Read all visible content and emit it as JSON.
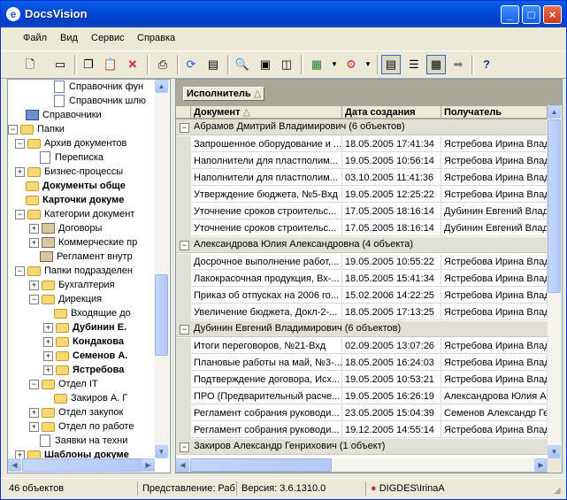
{
  "window": {
    "title": "DocsVision",
    "app_icon": "docsvision-logo-icon",
    "controls": [
      "minimize-icon",
      "maximize-icon",
      "close-icon"
    ]
  },
  "menu": [
    "Файл",
    "Вид",
    "Сервис",
    "Справка"
  ],
  "toolbar_icons": [
    "new-document-icon",
    "new-folder-icon",
    "copy-icon",
    "paste-icon",
    "delete-icon",
    "print-icon",
    "refresh-icon",
    "properties-icon",
    "search-icon",
    "find-card-icon",
    "find-folder-icon",
    "excel-export-icon",
    "settings-icon",
    "view-tree-icon",
    "view-list-icon",
    "view-details-icon",
    "forward-icon",
    "help-icon"
  ],
  "tree": {
    "items": [
      {
        "label": "Справочник фун",
        "level": 3,
        "icon": "reference-icon",
        "expander": "",
        "bold": false
      },
      {
        "label": "Справочник шлю",
        "level": 3,
        "icon": "reference-icon",
        "expander": "",
        "bold": false
      },
      {
        "label": "Справочники",
        "level": 1,
        "icon": "book-icon",
        "expander": "",
        "bold": false
      },
      {
        "label": "Папки",
        "level": 0,
        "icon": "folder-icon",
        "expander": "−",
        "bold": false
      },
      {
        "label": "Архив документов",
        "level": 1,
        "icon": "folder-icon",
        "expander": "−",
        "bold": false
      },
      {
        "label": "Переписка",
        "level": 2,
        "icon": "document-icon",
        "expander": "",
        "bold": false
      },
      {
        "label": "Бизнес-процессы",
        "level": 1,
        "icon": "folder-icon",
        "expander": "+",
        "bold": false
      },
      {
        "label": "Документы обще",
        "level": 1,
        "icon": "folder-icon",
        "expander": "",
        "bold": true
      },
      {
        "label": "Карточки докуме",
        "level": 1,
        "icon": "folder-icon",
        "expander": "",
        "bold": true
      },
      {
        "label": "Категории документ",
        "level": 1,
        "icon": "folder-icon",
        "expander": "−",
        "bold": false
      },
      {
        "label": "Договоры",
        "level": 2,
        "icon": "category-icon",
        "expander": "+",
        "bold": false
      },
      {
        "label": "Коммерческие пр",
        "level": 2,
        "icon": "category-icon",
        "expander": "+",
        "bold": false
      },
      {
        "label": "Регламент внутр",
        "level": 2,
        "icon": "category-icon",
        "expander": "",
        "bold": false
      },
      {
        "label": "Папки подразделен",
        "level": 1,
        "icon": "folder-icon",
        "expander": "−",
        "bold": false
      },
      {
        "label": "Бухгалтерия",
        "level": 2,
        "icon": "folder-icon",
        "expander": "+",
        "bold": false
      },
      {
        "label": "Дирекция",
        "level": 2,
        "icon": "folder-icon",
        "expander": "−",
        "bold": false
      },
      {
        "label": "Входящие до",
        "level": 3,
        "icon": "folder-icon",
        "expander": "",
        "bold": false
      },
      {
        "label": "Дубинин Е.",
        "level": 3,
        "icon": "folder-icon",
        "expander": "+",
        "bold": true
      },
      {
        "label": "Кондакова",
        "level": 3,
        "icon": "folder-icon",
        "expander": "+",
        "bold": true
      },
      {
        "label": "Семенов А.",
        "level": 3,
        "icon": "folder-icon",
        "expander": "+",
        "bold": true
      },
      {
        "label": "Ястребова",
        "level": 3,
        "icon": "folder-icon",
        "expander": "+",
        "bold": true
      },
      {
        "label": "Отдел IT",
        "level": 2,
        "icon": "folder-icon",
        "expander": "−",
        "bold": false
      },
      {
        "label": "Закиров А. Г",
        "level": 3,
        "icon": "folder-icon",
        "expander": "",
        "bold": false
      },
      {
        "label": "Отдел закупок",
        "level": 2,
        "icon": "folder-icon",
        "expander": "+",
        "bold": false
      },
      {
        "label": "Отдел по работе",
        "level": 2,
        "icon": "folder-icon",
        "expander": "+",
        "bold": false
      },
      {
        "label": "Заявки на техни",
        "level": 2,
        "icon": "document-icon",
        "expander": "",
        "bold": false
      },
      {
        "label": "Шаблоны докуме",
        "level": 1,
        "icon": "folder-icon",
        "expander": "+",
        "bold": true
      }
    ]
  },
  "grid": {
    "group_by_chip": "Исполнитель",
    "columns": [
      "Документ",
      "Дата создания",
      "Получатель"
    ],
    "groups": [
      {
        "title": "Абрамов Дмитрий Владимирович (6 объектов)",
        "rows": [
          [
            "Запрошенное оборудование и ...",
            "18.05.2005 17:41:34",
            "Ястребова Ирина Влад"
          ],
          [
            "Наполнители для пластполим...",
            "19.05.2005 10:56:14",
            "Ястребова Ирина Влад"
          ],
          [
            "Наполнители для пластполим...",
            "03.10.2005 11:41:36",
            "Ястребова Ирина Влад"
          ],
          [
            "Утверждение бюджета, №5-Вхд",
            "19.05.2005 12:25:22",
            "Ястребова Ирина Влад"
          ],
          [
            "Уточнение сроков строительс...",
            "17.05.2005 18:16:14",
            "Дубинин Евгений Влад"
          ],
          [
            "Уточнение сроков строительс...",
            "17.05.2005 18:16:14",
            "Дубинин Евгений Влад"
          ]
        ]
      },
      {
        "title": "Александрова Юлия Александровна (4 объекта)",
        "rows": [
          [
            "Досрочное выполнение работ,...",
            "19.05.2005 10:55:22",
            "Ястребова Ирина Влад"
          ],
          [
            "Лакокрасочная продукция, Вх-...",
            "18.05.2005 15:41:34",
            "Ястребова Ирина Влад"
          ],
          [
            "Приказ об отпусках на 2006 го...",
            "15.02.2006 14:22:25",
            "Ястребова Ирина Влад"
          ],
          [
            "Увеличение бюджета, Докл-2-...",
            "18.05.2005 17:13:25",
            "Ястребова Ирина Влад"
          ]
        ]
      },
      {
        "title": "Дубинин Евгений Владимирович (6 объектов)",
        "rows": [
          [
            "Итоги переговоров, №21-Вхд",
            "02.09.2005 13:07:26",
            "Ястребова Ирина Влад"
          ],
          [
            "Плановые работы на май, №3-...",
            "18.05.2005 16:24:03",
            "Ястребова Ирина Влад"
          ],
          [
            "Подтверждение договора, Исх...",
            "19.05.2005 10:53:21",
            "Ястребова Ирина Влад"
          ],
          [
            "ПРО (Предварительный расче...",
            "19.05.2005 16:26:19",
            "Александрова Юлия А"
          ],
          [
            "Регламент собрания руководи...",
            "23.05.2005 15:04:39",
            "Семенов Александр Ге"
          ],
          [
            "Регламент собрания руководи...",
            "19.12.2005 14:55:14",
            "Ястребова Ирина Влад"
          ]
        ]
      },
      {
        "title": "Закиров Александр Генрихович (1 объект)",
        "rows": []
      }
    ]
  },
  "status": {
    "count": "46 объектов",
    "view": "Представление: Раб",
    "version": "Версия: 3.6.1310.0",
    "user": "DIGDES\\IrinaA"
  }
}
